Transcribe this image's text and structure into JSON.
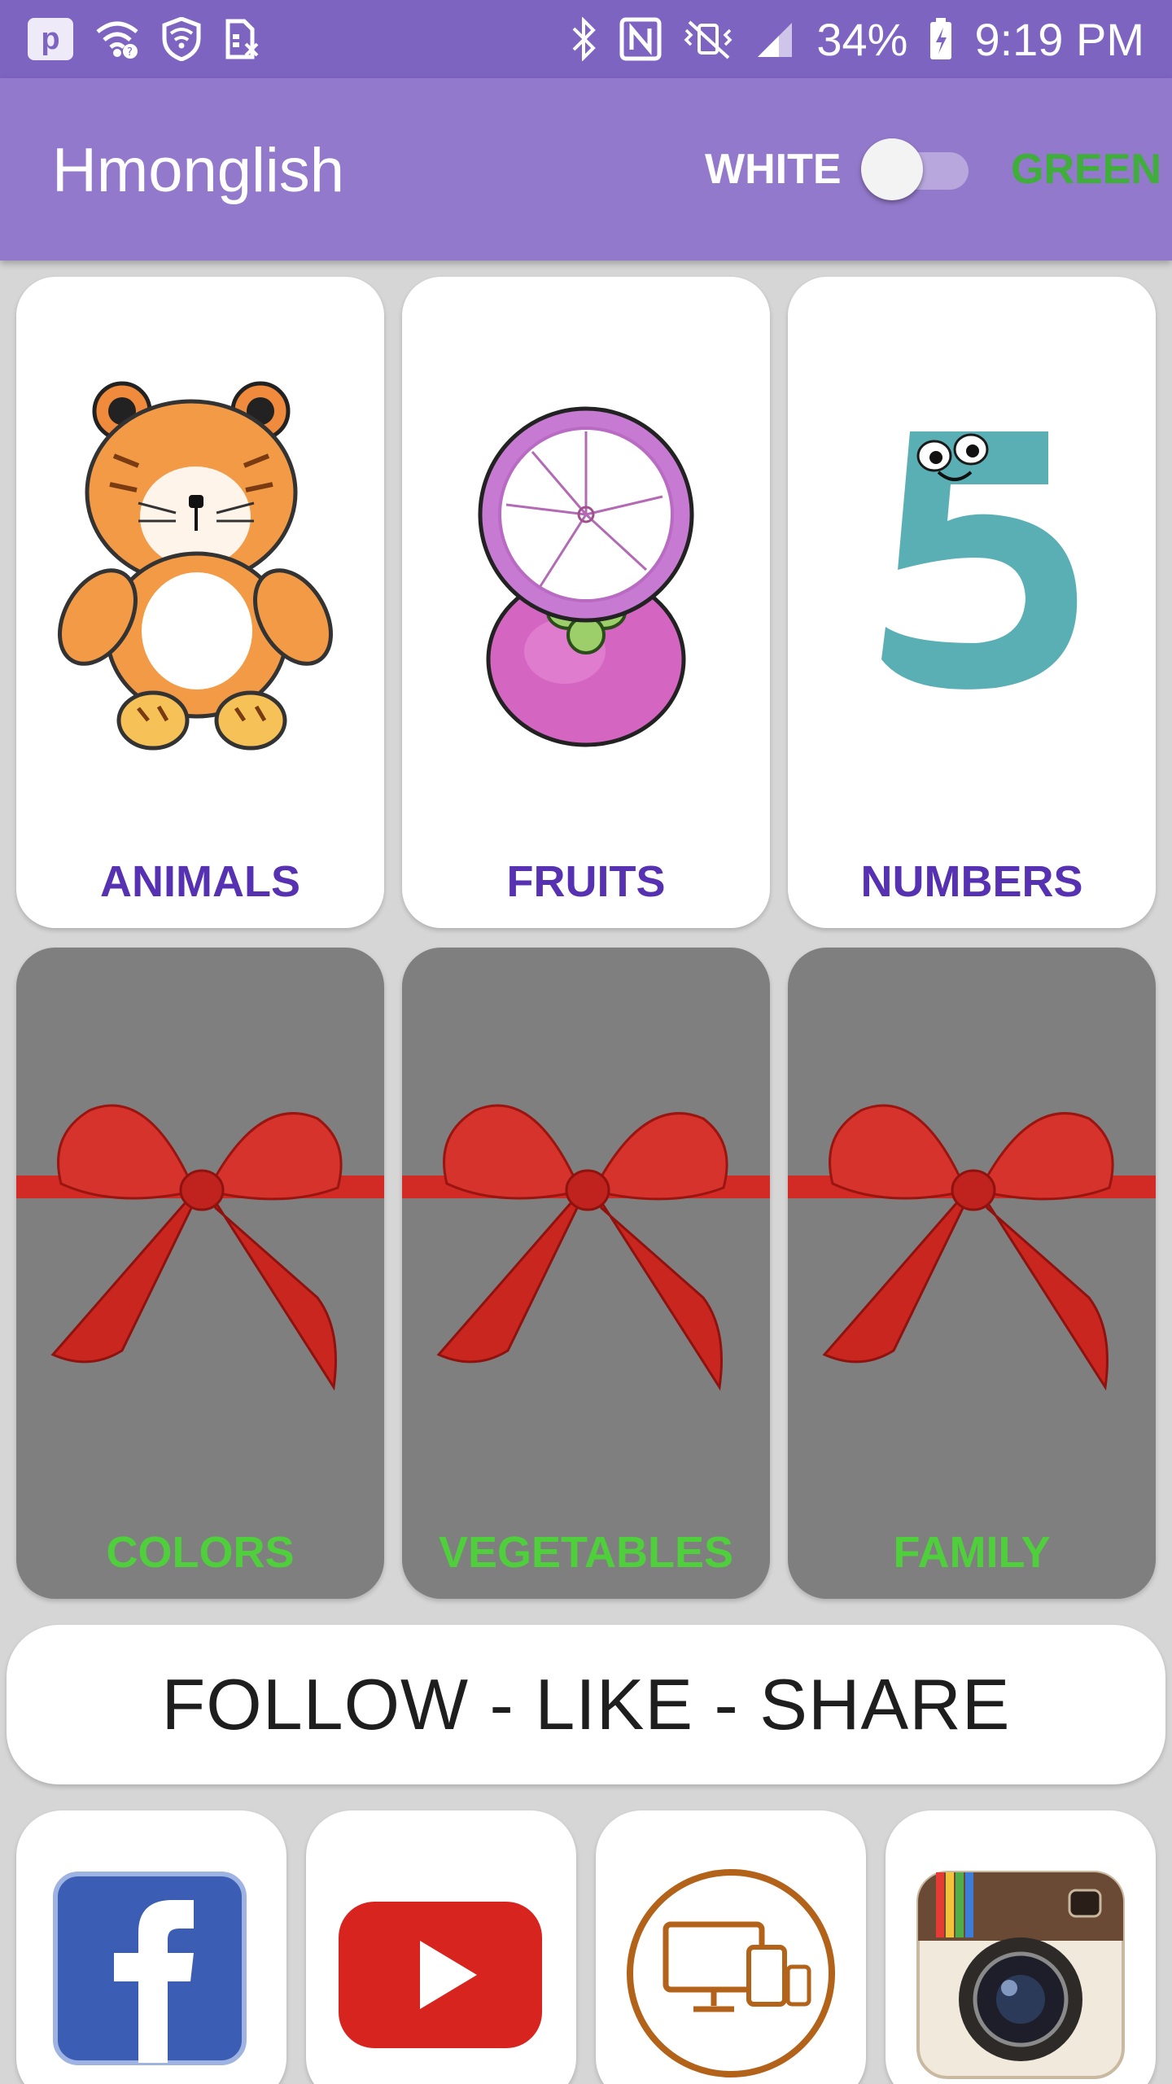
{
  "status_bar": {
    "battery": "34%",
    "time": "9:19 PM",
    "left_icons": [
      "pocket-icon",
      "wifi-icon",
      "shield-icon",
      "sim-icon"
    ],
    "right_icons": [
      "bluetooth-icon",
      "nfc-icon",
      "vibrate-icon",
      "signal-icon",
      "battery-icon"
    ]
  },
  "app_bar": {
    "title": "Hmonglish",
    "theme_toggle": {
      "left_label": "WHITE",
      "right_label": "GREEN",
      "checked": false
    }
  },
  "categories": [
    {
      "label": "ANIMALS",
      "locked": false,
      "image": "tiger-illustration"
    },
    {
      "label": "FRUITS",
      "locked": false,
      "image": "mangosteen-illustration"
    },
    {
      "label": "NUMBERS",
      "locked": false,
      "image": "number-five-illustration"
    },
    {
      "label": "COLORS",
      "locked": true,
      "image": "red-ribbon-bow"
    },
    {
      "label": "VEGETABLES",
      "locked": true,
      "image": "red-ribbon-bow"
    },
    {
      "label": "FAMILY",
      "locked": true,
      "image": "red-ribbon-bow"
    }
  ],
  "follow_banner": {
    "text": "FOLLOW - LIKE - SHARE"
  },
  "social_links": [
    {
      "name": "facebook-icon"
    },
    {
      "name": "youtube-icon"
    },
    {
      "name": "website-devices-icon"
    },
    {
      "name": "instagram-icon"
    }
  ],
  "colors": {
    "status_bar": "#7e64c1",
    "app_bar": "#9379cb",
    "unlocked_label": "#5631b1",
    "locked_label": "#4fcf3c",
    "green_label": "#3fae3a",
    "locked_card": "#7f7f7f"
  }
}
